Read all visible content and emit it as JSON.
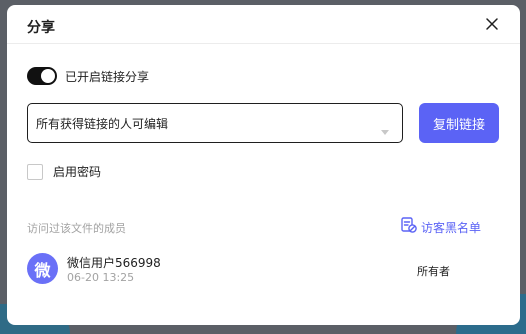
{
  "dialog": {
    "title": "分享",
    "close_icon": "close-icon"
  },
  "link_toggle": {
    "enabled": true,
    "label": "已开启链接分享"
  },
  "permission_select": {
    "value": "所有获得链接的人可编辑",
    "arrow_icon": "chevron-down-icon"
  },
  "copy_button": {
    "label": "复制链接",
    "color": "#5b63f5"
  },
  "password": {
    "checked": false,
    "label": "启用密码"
  },
  "members": {
    "section_label": "访问过该文件的成员",
    "blacklist_label": "访客黑名单",
    "blacklist_icon": "blacklist-icon",
    "items": [
      {
        "avatar_text": "微",
        "name": "微信用户566998",
        "time": "06-20 13:25",
        "role": "所有者"
      }
    ]
  }
}
